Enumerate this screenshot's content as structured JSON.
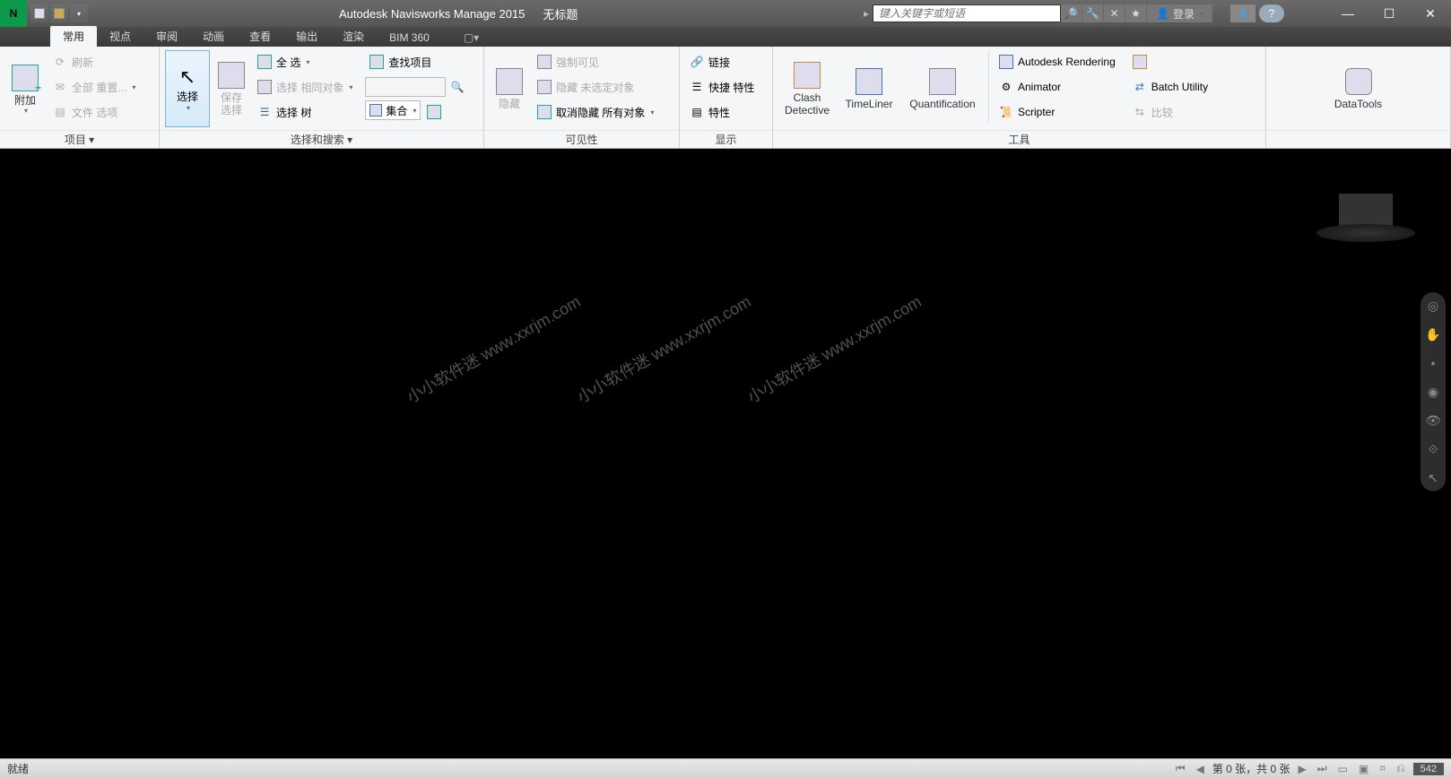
{
  "title": {
    "app": "Autodesk Navisworks Manage 2015",
    "document": "无标题"
  },
  "search": {
    "placeholder": "键入关键字或短语",
    "login": "登录"
  },
  "window_controls": {
    "min": "—",
    "max": "☐",
    "close": "✕"
  },
  "tabs": {
    "items": [
      "常用",
      "视点",
      "审阅",
      "动画",
      "查看",
      "输出",
      "渲染",
      "BIM 360"
    ],
    "active_index": 0
  },
  "ribbon": {
    "project": {
      "attach": "附加",
      "refresh": "刷新",
      "reset_all": "全部 重置...",
      "file_options": "文件 选项",
      "title": "项目 ▾"
    },
    "select_search": {
      "select": "选择",
      "save_selection": "保存\n选择",
      "select_all": "全 选",
      "select_same": "选择 相同对象",
      "select_tree": "选择 树",
      "find_items": "查找项目",
      "quick_find_placeholder": "",
      "sets": "集合",
      "title": "选择和搜索 ▾"
    },
    "visibility": {
      "hide": "隐藏",
      "require_visible": "强制可见",
      "hide_unselected": "隐藏 未选定对象",
      "unhide_all": "取消隐藏 所有对象",
      "title": "可见性"
    },
    "display": {
      "links": "链接",
      "quick_properties": "快捷 特性",
      "properties": "特性",
      "title": "显示"
    },
    "tools": {
      "clash_detective": "Clash\nDetective",
      "timeliner": "TimeLiner",
      "quantification": "Quantification",
      "autodesk_rendering": "Autodesk Rendering",
      "animator": "Animator",
      "scripter": "Scripter",
      "appearance_profiler_icon": "appearance-profiler",
      "batch_utility": "Batch Utility",
      "compare": "比较",
      "datatools": "DataTools",
      "title": "工具"
    }
  },
  "viewport": {
    "watermark": "小小软件迷 www.xxrjm.com"
  },
  "statusbar": {
    "ready": "就绪",
    "sheet_info": "第 0 张，共 0 张",
    "number": "542"
  },
  "infocenter": {
    "exchange": "X",
    "help": "?"
  }
}
